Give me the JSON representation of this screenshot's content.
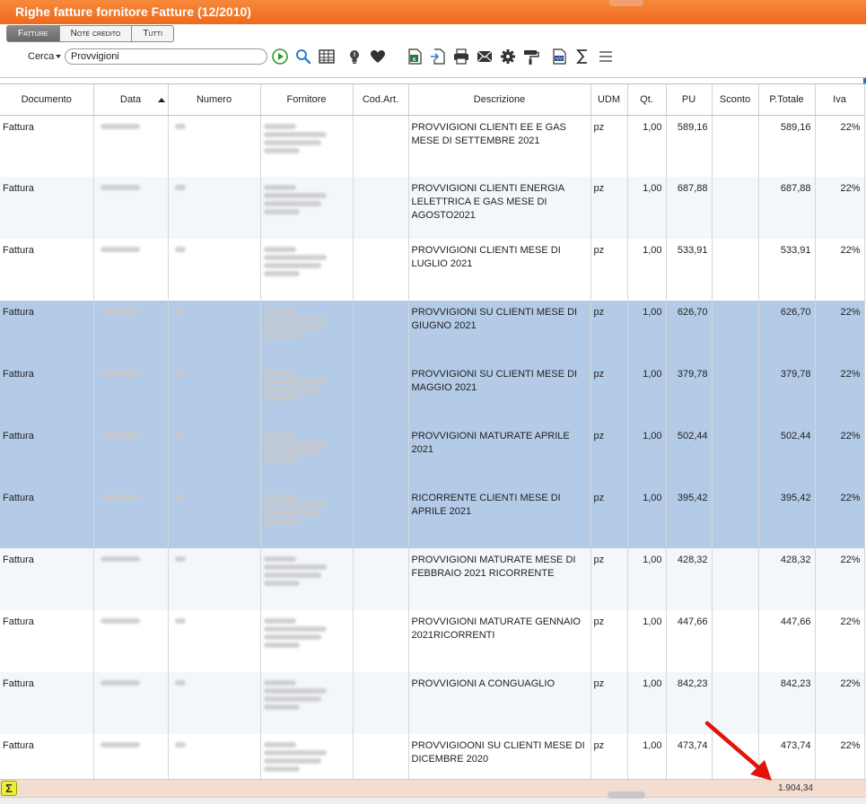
{
  "window": {
    "title": "Righe fatture fornitore Fatture (12/2010)"
  },
  "tabs": [
    {
      "label": "Fatture",
      "active": true
    },
    {
      "label": "Note credito",
      "active": false
    },
    {
      "label": "Tutti",
      "active": false
    }
  ],
  "search": {
    "label": "Cerca",
    "value": "Provvigioni"
  },
  "toolbar_icons": [
    "play-icon",
    "search-icon",
    "table-icon",
    "lightbulb-icon",
    "heart-icon",
    "excel-icon",
    "import-icon",
    "print-icon",
    "mail-icon",
    "gear-icon",
    "paint-roller-icon",
    "xml-icon",
    "sum-icon",
    "menu-icon"
  ],
  "columns": [
    "Documento",
    "Data",
    "Numero",
    "Fornitore",
    "Cod.Art.",
    "Descrizione",
    "UDM",
    "Qt.",
    "PU",
    "Sconto",
    "P.Totale",
    "Iva"
  ],
  "rows": [
    {
      "documento": "Fattura",
      "descrizione": "PROVVIGIONI CLIENTI EE E GAS MESE DI SETTEMBRE 2021",
      "udm": "pz",
      "qt": "1,00",
      "pu": "589,16",
      "sconto": "",
      "ptotale": "589,16",
      "iva": "22%",
      "selected": false
    },
    {
      "documento": "Fattura",
      "descrizione": "PROVVIGIONI CLIENTI ENERGIA LELETTRICA E GAS MESE DI AGOSTO2021",
      "udm": "pz",
      "qt": "1,00",
      "pu": "687,88",
      "sconto": "",
      "ptotale": "687,88",
      "iva": "22%",
      "selected": false
    },
    {
      "documento": "Fattura",
      "descrizione": "PROVVIGIONI CLIENTI MESE DI LUGLIO 2021",
      "udm": "pz",
      "qt": "1,00",
      "pu": "533,91",
      "sconto": "",
      "ptotale": "533,91",
      "iva": "22%",
      "selected": false
    },
    {
      "documento": "Fattura",
      "descrizione": "PROVVIGIONI SU CLIENTI MESE DI GIUGNO 2021",
      "udm": "pz",
      "qt": "1,00",
      "pu": "626,70",
      "sconto": "",
      "ptotale": "626,70",
      "iva": "22%",
      "selected": true
    },
    {
      "documento": "Fattura",
      "descrizione": "PROVVIGIONI SU CLIENTI MESE DI MAGGIO 2021",
      "udm": "pz",
      "qt": "1,00",
      "pu": "379,78",
      "sconto": "",
      "ptotale": "379,78",
      "iva": "22%",
      "selected": true
    },
    {
      "documento": "Fattura",
      "descrizione": "PROVVIGIONI MATURATE APRILE 2021",
      "udm": "pz",
      "qt": "1,00",
      "pu": "502,44",
      "sconto": "",
      "ptotale": "502,44",
      "iva": "22%",
      "selected": true
    },
    {
      "documento": "Fattura",
      "descrizione": "RICORRENTE CLIENTI MESE DI APRILE 2021",
      "udm": "pz",
      "qt": "1,00",
      "pu": "395,42",
      "sconto": "",
      "ptotale": "395,42",
      "iva": "22%",
      "selected": true
    },
    {
      "documento": "Fattura",
      "descrizione": "PROVVIGIONI MATURATE MESE DI FEBBRAIO 2021 RICORRENTE",
      "udm": "pz",
      "qt": "1,00",
      "pu": "428,32",
      "sconto": "",
      "ptotale": "428,32",
      "iva": "22%",
      "selected": false
    },
    {
      "documento": "Fattura",
      "descrizione": "PROVVIGIONI MATURATE GENNAIO 2021RICORRENTI",
      "udm": "pz",
      "qt": "1,00",
      "pu": "447,66",
      "sconto": "",
      "ptotale": "447,66",
      "iva": "22%",
      "selected": false
    },
    {
      "documento": "Fattura",
      "descrizione": "PROVVIGIONI A CONGUAGLIO",
      "udm": "pz",
      "qt": "1,00",
      "pu": "842,23",
      "sconto": "",
      "ptotale": "842,23",
      "iva": "22%",
      "selected": false
    },
    {
      "documento": "Fattura",
      "descrizione": "PROVVIGIOONI SU CLIENTI MESE DI DICEMBRE 2020",
      "udm": "pz",
      "qt": "1,00",
      "pu": "473,74",
      "sconto": "",
      "ptotale": "473,74",
      "iva": "22%",
      "selected": false
    }
  ],
  "footer": {
    "sum_symbol": "Σ",
    "total": "1.904,34"
  },
  "colors": {
    "title_orange": "#ee6a1c",
    "selection_blue": "#b3cbe7",
    "annotation_red": "#e3120b",
    "footer_bg": "#f3ddd0"
  }
}
